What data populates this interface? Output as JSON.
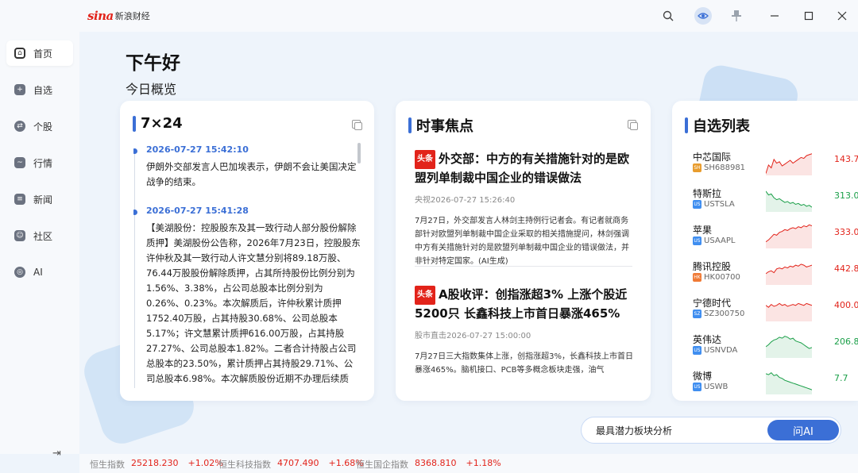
{
  "app": {
    "logo_mark": "sina",
    "logo_text": "新浪财经"
  },
  "titlebar": {
    "icons": [
      "search-icon",
      "eye-icon",
      "pin-icon",
      "minimize-icon",
      "maximize-icon",
      "close-icon"
    ]
  },
  "sidebar": {
    "items": [
      {
        "label": "首页",
        "icon": "home-icon"
      },
      {
        "label": "自选",
        "icon": "plus-icon"
      },
      {
        "label": "个股",
        "icon": "swap-icon"
      },
      {
        "label": "行情",
        "icon": "trend-icon"
      },
      {
        "label": "新闻",
        "icon": "news-icon"
      },
      {
        "label": "社区",
        "icon": "community-icon"
      },
      {
        "label": "AI",
        "icon": "ai-icon"
      }
    ],
    "active": "首页"
  },
  "main": {
    "greeting": "下午好",
    "subtitle": "今日概览"
  },
  "live": {
    "title": "7×24",
    "items": [
      {
        "time": "2026-07-27 15:42:10",
        "text": "伊朗外交部发言人巴加埃表示，伊朗不会让美国决定战争的结束。"
      },
      {
        "time": "2026-07-27 15:41:28",
        "text": "【美湖股份：控股股东及其一致行动人部分股份解除质押】美湖股份公告称，2026年7月23日，控股股东许仲秋及其一致行动人许文慧分别将89.18万股、76.44万股股份解除质押，占其所持股份比例分别为1.56%、3.38%，占公司总股本比例分别为0.26%、0.23%。本次解质后，许仲秋累计质押1752.40万股，占其持股30.68%、公司总股本5.17%；许文慧累计质押616.00万股，占其持股27.27%、公司总股本1.82%。二者合计持股占公司总股本的23.50%，累计质押占其持股29.71%、公司总股本6.98%。本次解质股份近期不办理后续质押。"
      }
    ]
  },
  "focus": {
    "title": "时事焦点",
    "badge": "头条",
    "items": [
      {
        "title": "外交部：中方的有关措施针对的是欧盟列单制裁中国企业的错误做法",
        "meta": "央视2026-07-27 15:26:40",
        "body": "7月27日，外交部发言人林剑主持例行记者会。有记者就商务部针对欧盟列单制裁中国企业采取的相关措施提问，林剑强调中方有关措施针对的是欧盟列单制裁中国企业的错误做法，并非针对特定国家。(AI生成)"
      },
      {
        "title": "A股收评：创指涨超3% 上涨个股近5200只 长鑫科技上市首日暴涨465%",
        "meta": "股市直击2026-07-27 15:00:00",
        "body": "7月27日三大指数集体上涨，创指涨超3%，长鑫科技上市首日暴涨465%。脑机接口、PCB等多概念板块走强，油气"
      }
    ]
  },
  "watchlist": {
    "title": "自选列表",
    "stocks": [
      {
        "name": "中芯国际",
        "market": "SH",
        "code": "SH688981",
        "price": "143.7",
        "dir": "up",
        "spark": [
          60,
          42,
          48,
          30,
          38,
          35,
          44,
          40,
          36,
          32,
          38,
          34,
          30,
          26,
          28,
          22,
          20,
          18
        ]
      },
      {
        "name": "特斯拉",
        "market": "US",
        "code": "USTSLA",
        "price": "313.0",
        "dir": "down",
        "spark": [
          20,
          28,
          26,
          34,
          38,
          36,
          40,
          44,
          42,
          46,
          44,
          48,
          46,
          50,
          48,
          52,
          50,
          54
        ]
      },
      {
        "name": "苹果",
        "market": "US",
        "code": "USAAPL",
        "price": "333.0",
        "dir": "up",
        "spark": [
          50,
          46,
          40,
          34,
          36,
          30,
          28,
          24,
          26,
          22,
          20,
          22,
          18,
          20,
          16,
          18,
          14,
          16
        ]
      },
      {
        "name": "腾讯控股",
        "market": "HK",
        "code": "HK00700",
        "price": "442.8",
        "dir": "up",
        "spark": [
          40,
          36,
          34,
          38,
          30,
          28,
          30,
          26,
          28,
          24,
          26,
          22,
          24,
          20,
          22,
          26,
          24,
          22
        ]
      },
      {
        "name": "宁德时代",
        "market": "SZ",
        "code": "SZ300750",
        "price": "400.0",
        "dir": "up",
        "spark": [
          30,
          34,
          28,
          32,
          30,
          26,
          30,
          28,
          32,
          30,
          28,
          30,
          26,
          28,
          30,
          26,
          28,
          30
        ]
      },
      {
        "name": "英伟达",
        "market": "US",
        "code": "USNVDA",
        "price": "206.8",
        "dir": "down",
        "spark": [
          40,
          36,
          30,
          26,
          24,
          20,
          22,
          18,
          20,
          24,
          22,
          28,
          30,
          32,
          36,
          40,
          44,
          42
        ]
      },
      {
        "name": "微博",
        "market": "US",
        "code": "USWB",
        "price": "7.7",
        "dir": "down",
        "spark": [
          20,
          22,
          18,
          24,
          22,
          28,
          30,
          34,
          36,
          38,
          40,
          42,
          44,
          46,
          48,
          50,
          52,
          54
        ]
      }
    ]
  },
  "ai": {
    "prompt": "最具潜力板块分析",
    "button": "问AI"
  },
  "ticker": [
    {
      "name": "恒生指数",
      "value": "25218.230",
      "change": "+1.02%"
    },
    {
      "name": "恒生科技指数",
      "value": "4707.490",
      "change": "+1.68%"
    },
    {
      "name": "恒生国企指数",
      "value": "8368.810",
      "change": "+1.18%"
    }
  ],
  "colors": {
    "accent": "#3b6fd6",
    "up": "#e2231a",
    "down": "#1a9f48",
    "badge": "#e2231a"
  }
}
